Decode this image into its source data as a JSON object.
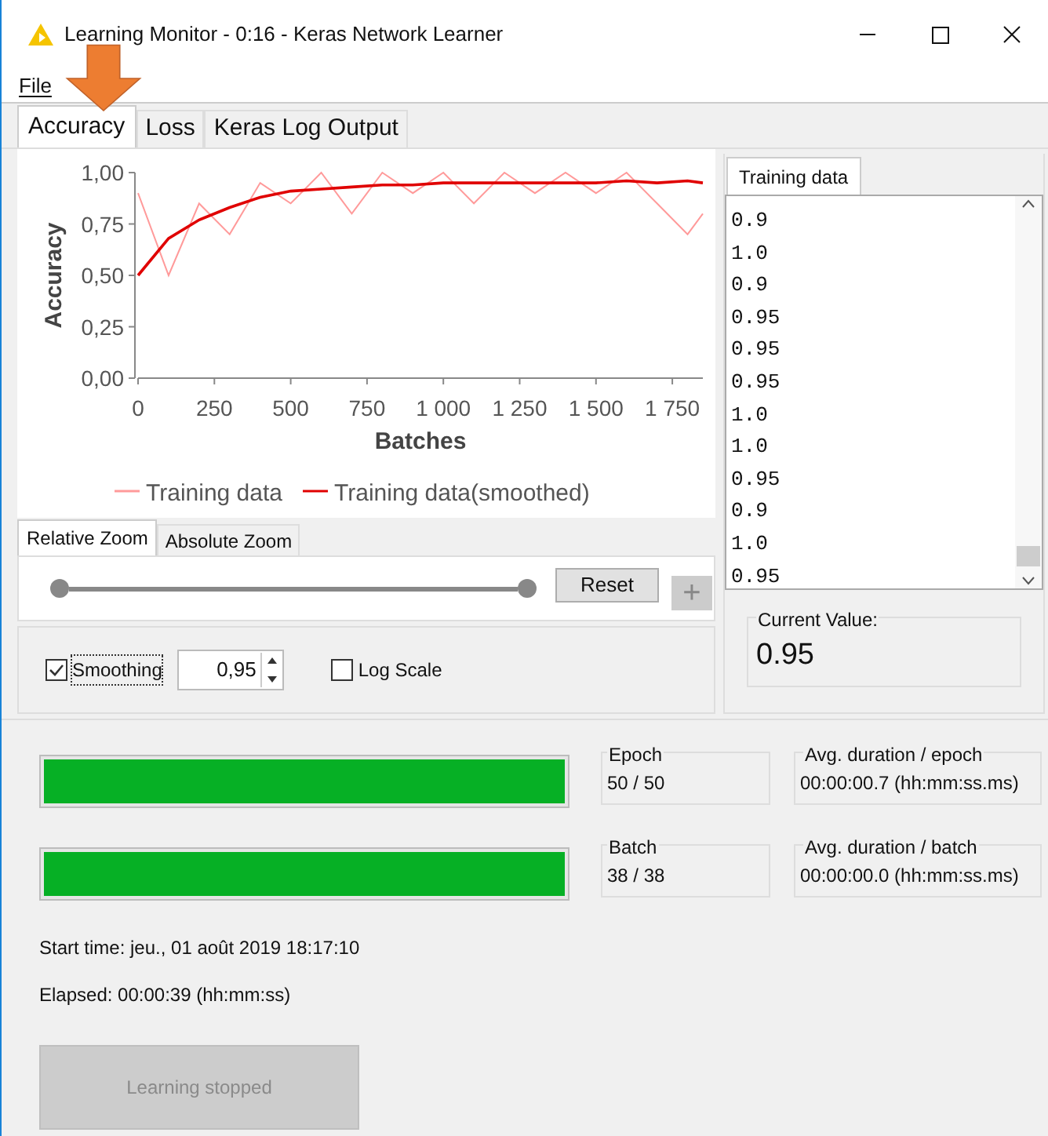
{
  "window": {
    "title": "Learning Monitor - 0:16 - Keras Network Learner"
  },
  "menu": [
    "File"
  ],
  "tabs": [
    {
      "label": "Accuracy",
      "selected": true
    },
    {
      "label": "Loss",
      "selected": false
    },
    {
      "label": "Keras Log Output",
      "selected": false
    }
  ],
  "chart": {
    "chart_data": {
      "type": "line",
      "xlabel": "Batches",
      "ylabel": "Accuracy",
      "x": [
        0,
        100,
        200,
        300,
        400,
        500,
        600,
        700,
        800,
        900,
        1000,
        1100,
        1200,
        1300,
        1400,
        1500,
        1600,
        1700,
        1800,
        1850
      ],
      "series": [
        {
          "name": "Training data",
          "color": "#ff9a9a",
          "values": [
            0.9,
            0.5,
            0.85,
            0.7,
            0.95,
            0.85,
            1.0,
            0.8,
            1.0,
            0.9,
            1.0,
            0.85,
            1.0,
            0.9,
            1.0,
            0.9,
            1.0,
            0.85,
            0.7,
            0.8
          ]
        },
        {
          "name": "Training data(smoothed)",
          "color": "#e00000",
          "values": [
            0.5,
            0.68,
            0.77,
            0.83,
            0.88,
            0.91,
            0.92,
            0.93,
            0.94,
            0.94,
            0.95,
            0.95,
            0.95,
            0.95,
            0.95,
            0.95,
            0.96,
            0.95,
            0.96,
            0.95
          ]
        }
      ],
      "xlim": [
        0,
        1850
      ],
      "ylim": [
        0,
        1
      ],
      "legend": "bottom",
      "xticks": [
        {
          "value": 0,
          "label": "0"
        },
        {
          "value": 250,
          "label": "250"
        },
        {
          "value": 500,
          "label": "500"
        },
        {
          "value": 750,
          "label": "750"
        },
        {
          "value": 1000,
          "label": "1 000"
        },
        {
          "value": 1250,
          "label": "1 250"
        },
        {
          "value": 1500,
          "label": "1 500"
        },
        {
          "value": 1750,
          "label": "1 750"
        }
      ],
      "yticks": [
        {
          "value": 0,
          "label": "0,00"
        },
        {
          "value": 0.25,
          "label": "0,25"
        },
        {
          "value": 0.5,
          "label": "0,50"
        },
        {
          "value": 0.75,
          "label": "0,75"
        },
        {
          "value": 1,
          "label": "1,00"
        }
      ]
    }
  },
  "zoom_tabs": [
    {
      "label": "Relative Zoom",
      "selected": true
    },
    {
      "label": "Absolute Zoom",
      "selected": false
    }
  ],
  "zoom": {
    "level": 1,
    "reset": "Reset",
    "add": "+"
  },
  "options": [
    {
      "kind": "checkbox",
      "label": "Smoothing",
      "checked": true
    },
    {
      "kind": "spinner",
      "value": "0,95"
    },
    {
      "kind": "checkbox",
      "label": "Log Scale",
      "checked": false
    }
  ],
  "data_panel": {
    "tab": "Training data",
    "values": [
      "0.9",
      "1.0",
      "0.9",
      "0.95",
      "0.95",
      "0.95",
      "1.0",
      "1.0",
      "0.95",
      "0.9",
      "1.0",
      "0.95"
    ],
    "current_label": "Current Value:",
    "current_value": "0.95"
  },
  "progress": [
    {
      "level": 1,
      "label": "Epoch",
      "value": "50 / 50",
      "duration_label": "Avg. duration / epoch",
      "duration": "00:00:00.7 (hh:mm:ss.ms)"
    },
    {
      "level": 1,
      "label": "Batch",
      "value": "38 / 38",
      "duration_label": "Avg. duration / batch",
      "duration": "00:00:00.0 (hh:mm:ss.ms)"
    }
  ],
  "start_time": "Start time: jeu., 01 août 2019 18:17:10",
  "elapsed": "Elapsed: 00:00:39 (hh:mm:ss)",
  "action_button": {
    "label": "Learning stopped",
    "disabled": true
  }
}
